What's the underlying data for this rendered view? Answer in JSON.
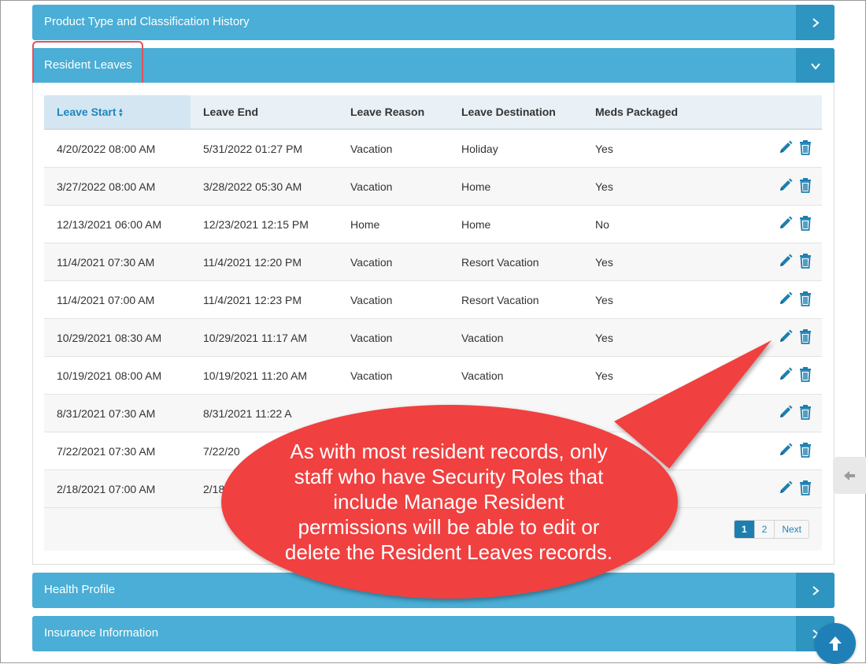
{
  "panels": {
    "product_history": "Product Type and Classification History",
    "resident_leaves": "Resident Leaves",
    "health_profile": "Health Profile",
    "insurance": "Insurance Information"
  },
  "table": {
    "headers": [
      "Leave Start",
      "Leave End",
      "Leave Reason",
      "Leave Destination",
      "Meds Packaged"
    ],
    "sort_indicator": "▲▼",
    "rows": [
      [
        "4/20/2022 08:00 AM",
        "5/31/2022 01:27 PM",
        "Vacation",
        "Holiday",
        "Yes"
      ],
      [
        "3/27/2022 08:00 AM",
        "3/28/2022 05:30 AM",
        "Vacation",
        "Home",
        "Yes"
      ],
      [
        "12/13/2021 06:00 AM",
        "12/23/2021 12:15 PM",
        "Home",
        "Home",
        "No"
      ],
      [
        "11/4/2021 07:30 AM",
        "11/4/2021 12:20 PM",
        "Vacation",
        "Resort Vacation",
        "Yes"
      ],
      [
        "11/4/2021 07:00 AM",
        "11/4/2021 12:23 PM",
        "Vacation",
        "Resort Vacation",
        "Yes"
      ],
      [
        "10/29/2021 08:30 AM",
        "10/29/2021 11:17 AM",
        "Vacation",
        "Vacation",
        "Yes"
      ],
      [
        "10/19/2021 08:00 AM",
        "10/19/2021 11:20 AM",
        "Vacation",
        "Vacation",
        "Yes"
      ],
      [
        "8/31/2021 07:30 AM",
        "8/31/2021 11:22 A",
        "",
        "",
        ""
      ],
      [
        "7/22/2021 07:30 AM",
        "7/22/20",
        "",
        "",
        ""
      ],
      [
        "2/18/2021 07:00 AM",
        "2/18",
        "",
        "",
        ""
      ]
    ]
  },
  "pagination": {
    "pages": [
      "1",
      "2"
    ],
    "next_label": "Next",
    "current": "1"
  },
  "callout": {
    "lines": [
      "As with most resident records, only",
      "staff who have Security Roles that",
      "include Manage Resident",
      "permissions will be able to edit or",
      "delete the Resident Leaves records."
    ]
  },
  "colors": {
    "panel": "#4aaed6",
    "panel_button": "#2e95c1",
    "callout": "#f04040",
    "highlight": "#e0525b",
    "icon": "#1c7fb0"
  }
}
